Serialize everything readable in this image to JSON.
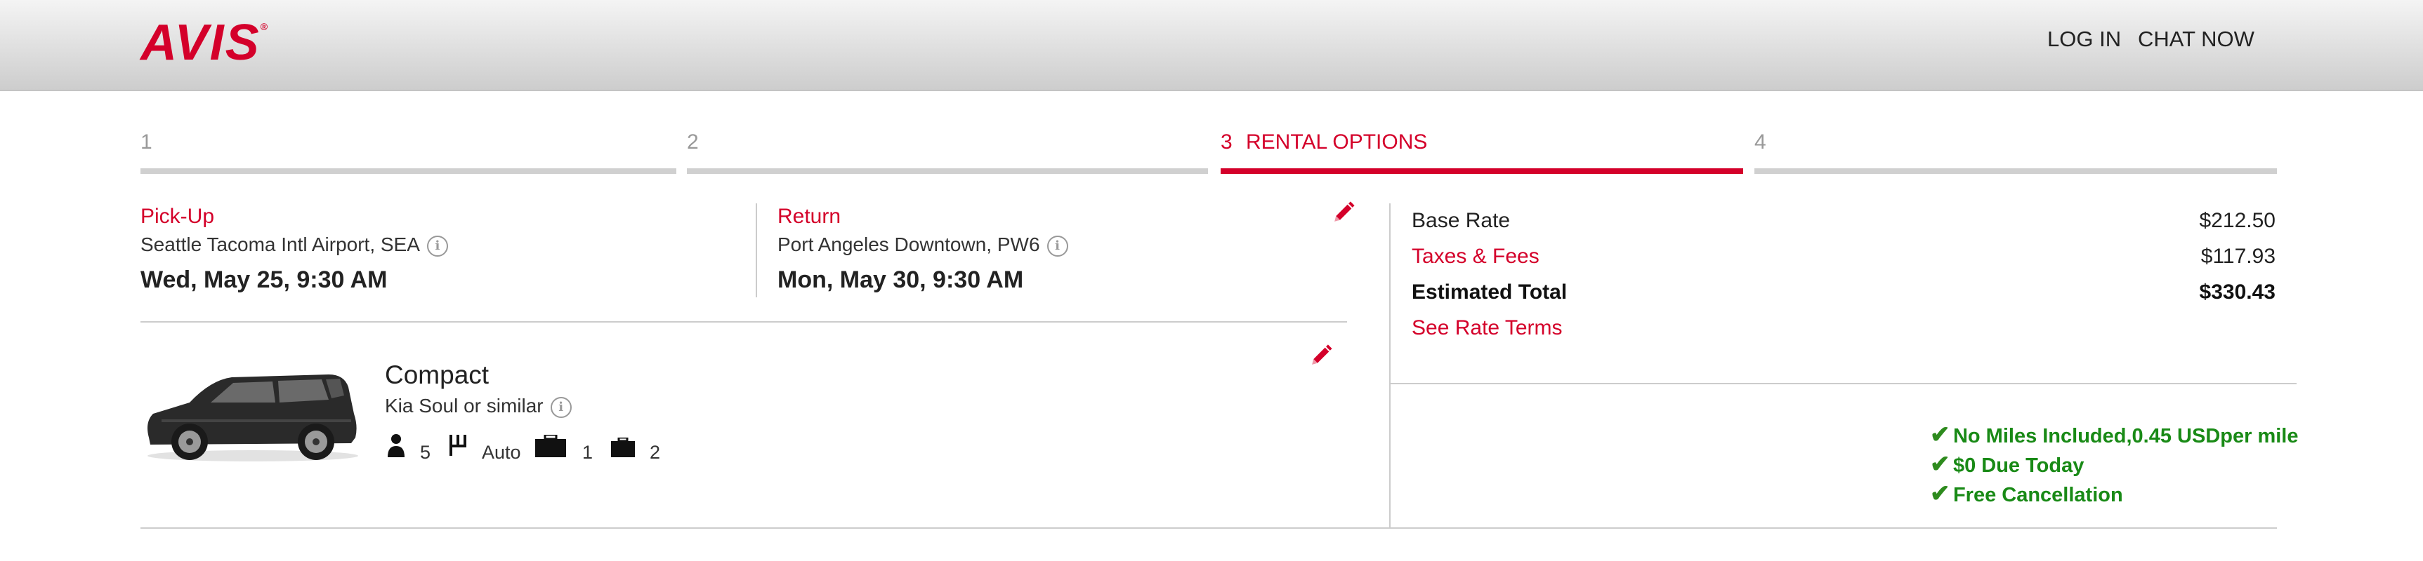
{
  "header": {
    "logo": "AVIS",
    "logo_mark": "®",
    "login": "LOG IN",
    "chat": "CHAT NOW"
  },
  "steps": [
    {
      "num": "1",
      "label": ""
    },
    {
      "num": "2",
      "label": ""
    },
    {
      "num": "3",
      "label": "RENTAL OPTIONS",
      "active": true
    },
    {
      "num": "4",
      "label": ""
    }
  ],
  "pickup": {
    "heading": "Pick-Up",
    "location": "Seattle Tacoma Intl Airport, SEA",
    "datetime": "Wed, May 25, 9:30 AM"
  },
  "return": {
    "heading": "Return",
    "location": "Port Angeles Downtown, PW6",
    "datetime": "Mon, May 30, 9:30 AM"
  },
  "vehicle": {
    "class": "Compact",
    "model": "Kia Soul or similar",
    "passengers": "5",
    "transmission": "Auto",
    "large_bags": "1",
    "small_bags": "2"
  },
  "pricing": {
    "base_rate_label": "Base Rate",
    "base_rate": "$212.50",
    "taxes_label": "Taxes & Fees",
    "taxes": "$117.93",
    "total_label": "Estimated Total",
    "total": "$330.43",
    "terms_link": "See Rate Terms"
  },
  "benefits": [
    "No Miles Included,0.45 USDper mile",
    "$0 Due Today",
    "Free Cancellation"
  ],
  "colors": {
    "brand": "#d4002a",
    "success": "#198a16"
  }
}
